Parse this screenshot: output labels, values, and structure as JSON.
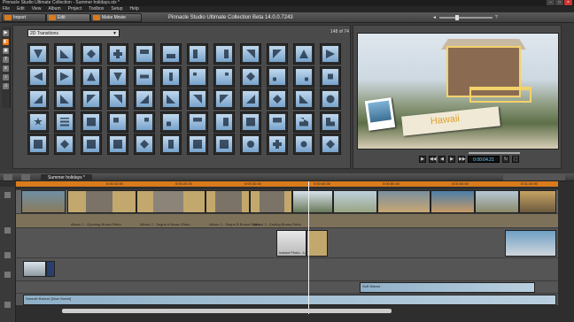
{
  "window": {
    "title": "Pinnacle Studio Ultimate Collection - Summer holidays.stx *",
    "min": "–",
    "max": "□",
    "close": "×"
  },
  "menu": [
    "File",
    "Edit",
    "View",
    "Album",
    "Project",
    "Toolbox",
    "Setup",
    "Help"
  ],
  "tabs": [
    {
      "label": "Import",
      "color": "#d67a1c"
    },
    {
      "label": "Edit",
      "color": "#d67a1c"
    },
    {
      "label": "Make Movie",
      "color": "#d67a1c"
    }
  ],
  "app_title": "Pinnacle Studio Ultimate Collection Beta 14.0.0.7243",
  "library": {
    "selector": "2D Transitions",
    "arrow": "▼"
  },
  "preview": {
    "count": "148 of 74",
    "banner": "Hawaii",
    "timecode": "0:00:04.21"
  },
  "timeline": {
    "project_tab": "Summer holidays *",
    "ruler": [
      "0:00:00.00",
      "0:00:10.00",
      "0:00:20.00",
      "0:00:30.00",
      "0:00:40.00",
      "0:00:50.00",
      "0:01:00.00",
      "0:01:10.00"
    ],
    "labels": {
      "album1": "Album 2 - Opening Brown Retro",
      "album2": "Album 2 - Segue A Brown Retro",
      "album3": "Album 2 - Segue B Brown Retro",
      "album4": "Album 2 - Ending Brown Retro",
      "photo": "Instant Photo - Loose (s)",
      "music": "Soft Waves",
      "audio": "Smooth Breeze [Now Sweet]"
    }
  }
}
